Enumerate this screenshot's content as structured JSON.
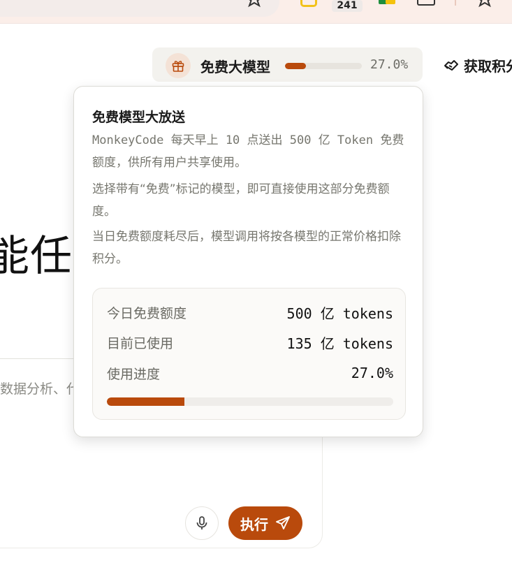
{
  "browser": {
    "extension_badge": "241"
  },
  "header": {
    "free_models": {
      "title": "免费大模型",
      "progress_fraction": 0.27,
      "progress_text": "27.0%"
    },
    "credits_link": "获取积分"
  },
  "main": {
    "hero_title": "能任务",
    "input_placeholder": "数据分析、代",
    "execute_label": "执行"
  },
  "popover": {
    "title": "免费模型大放送",
    "paragraphs": [
      "MonkeyCode 每天早上 10 点送出 500 亿 Token 免费额度，供所有用户共享使用。",
      "选择带有“免费”标记的模型，即可直接使用这部分免费额度。",
      "当日免费额度耗尽后，模型调用将按各模型的正常价格扣除积分。"
    ],
    "stats": {
      "daily_quota_label": "今日免费额度",
      "daily_quota_value": "500 亿 tokens",
      "used_label": "目前已使用",
      "used_value": "135 亿 tokens",
      "progress_label": "使用进度",
      "progress_value": "27.0%",
      "progress_fraction": 0.27
    }
  },
  "colors": {
    "accent": "#b94a0c",
    "muted_text": "#76766e",
    "pill_bg": "#f3f2ee"
  },
  "icons": [
    "star-icon",
    "extension-icon",
    "window-icon",
    "gift-icon",
    "credits-icon",
    "microphone-icon",
    "send-icon"
  ]
}
